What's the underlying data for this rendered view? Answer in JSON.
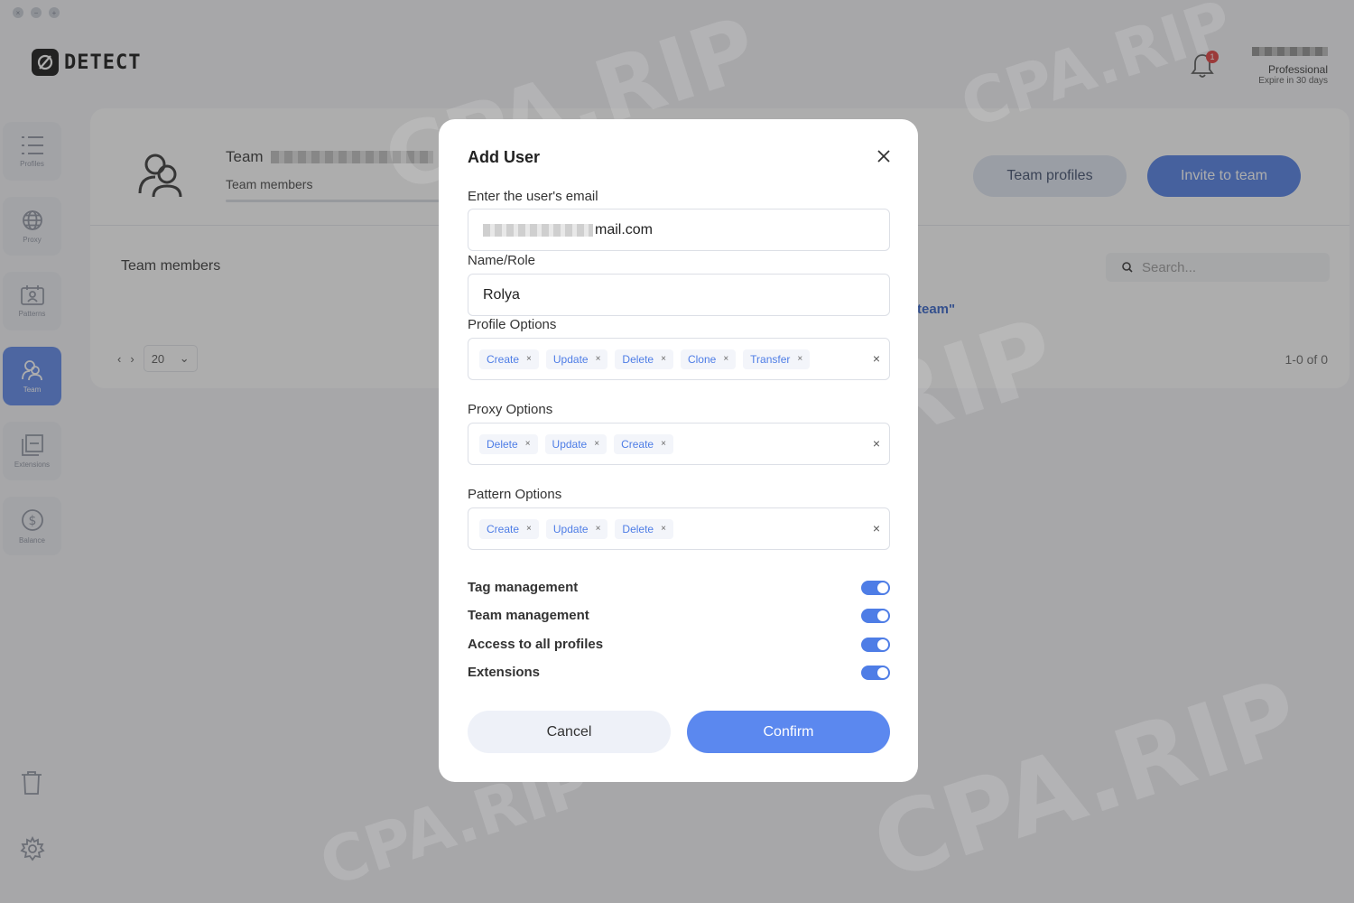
{
  "window": {
    "controls": [
      "×",
      "−",
      "+"
    ]
  },
  "brand": {
    "name": "DETECT"
  },
  "header": {
    "notification_count": "1",
    "plan": "Professional",
    "expire": "Expire in 30 days"
  },
  "sidebar": {
    "items": [
      {
        "label": "Profiles",
        "icon": "list-icon"
      },
      {
        "label": "Proxy",
        "icon": "globe-icon"
      },
      {
        "label": "Patterns",
        "icon": "calendar-user-icon"
      },
      {
        "label": "Team",
        "icon": "team-icon",
        "active": true
      },
      {
        "label": "Extensions",
        "icon": "extensions-icon"
      },
      {
        "label": "Balance",
        "icon": "dollar-icon"
      }
    ]
  },
  "team": {
    "title": "Team",
    "subtitle": "Team members",
    "team_profiles_label": "Team profiles",
    "invite_label": "Invite to team",
    "members_label": "Team members",
    "search_placeholder": "Search...",
    "empty_hint": "team\"",
    "page_size": "20",
    "range": "1-0 of 0"
  },
  "modal": {
    "title": "Add User",
    "email_label": "Enter the user's email",
    "email_value_suffix": "mail.com",
    "name_label": "Name/Role",
    "name_value": "Rolya",
    "profile_options_label": "Profile Options",
    "profile_options": [
      "Create",
      "Update",
      "Delete",
      "Clone",
      "Transfer"
    ],
    "proxy_options_label": "Proxy Options",
    "proxy_options": [
      "Delete",
      "Update",
      "Create"
    ],
    "pattern_options_label": "Pattern Options",
    "pattern_options": [
      "Create",
      "Update",
      "Delete"
    ],
    "toggles": [
      {
        "label": "Tag management",
        "on": true
      },
      {
        "label": "Team management",
        "on": true
      },
      {
        "label": "Access to all profiles",
        "on": true
      },
      {
        "label": "Extensions",
        "on": true
      }
    ],
    "cancel_label": "Cancel",
    "confirm_label": "Confirm"
  },
  "watermark": {
    "text": "CPA.RIP"
  },
  "colors": {
    "accent": "#4e7de6",
    "badge": "#e03a3a"
  }
}
